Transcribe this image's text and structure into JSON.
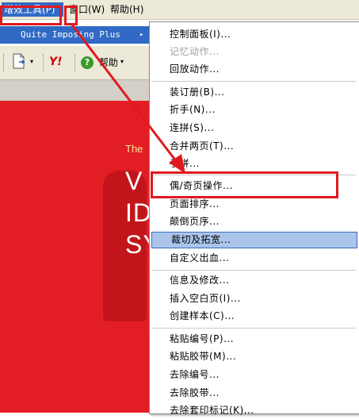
{
  "menubar": {
    "items": [
      "增效工具(P)",
      "窗口(W)",
      "帮助(H)"
    ]
  },
  "submenu": {
    "label": "Quite Imposing Plus",
    "arrow": "▸"
  },
  "toolbar": {
    "help_label": "帮助",
    "help_symbol": "?",
    "yahoo_label": "Y!",
    "dropdown_glyph": "▾"
  },
  "document": {
    "text_the": "The",
    "big_lines": [
      "V",
      "ID",
      "SY"
    ]
  },
  "context_menu": {
    "items": [
      {
        "label": "控制面板(I)...",
        "disabled": false
      },
      {
        "label": "记忆动作...",
        "disabled": true
      },
      {
        "label": "回放动作...",
        "disabled": false
      },
      {
        "label": "装订册(B)...",
        "disabled": false
      },
      {
        "label": "折手(N)...",
        "disabled": false
      },
      {
        "label": "连拼(S)...",
        "disabled": false
      },
      {
        "label": "合并两页(T)...",
        "disabled": false
      },
      {
        "label": "手拼...",
        "disabled": false
      },
      {
        "label": "偶/奇页操作...",
        "disabled": false
      },
      {
        "label": "页面排序...",
        "disabled": false
      },
      {
        "label": "颠倒页序...",
        "disabled": false
      },
      {
        "label": "裁切及拓宽...",
        "disabled": false
      },
      {
        "label": "自定义出血...",
        "disabled": false
      },
      {
        "label": "信息及修改...",
        "disabled": false
      },
      {
        "label": "插入空白页(I)...",
        "disabled": false
      },
      {
        "label": "创建样本(C)...",
        "disabled": false
      },
      {
        "label": "粘贴编号(P)...",
        "disabled": false
      },
      {
        "label": "粘贴胶带(M)...",
        "disabled": false
      },
      {
        "label": "去除编号...",
        "disabled": false
      },
      {
        "label": "去除胶带...",
        "disabled": false
      },
      {
        "label": "去除套印标记(K)...",
        "disabled": false
      }
    ],
    "highlighted_index": 11
  },
  "colors": {
    "accent": "#316ac5",
    "annotation_red": "#e0191f",
    "document_red": "#e31d24",
    "highlight": "#aac4ea"
  }
}
